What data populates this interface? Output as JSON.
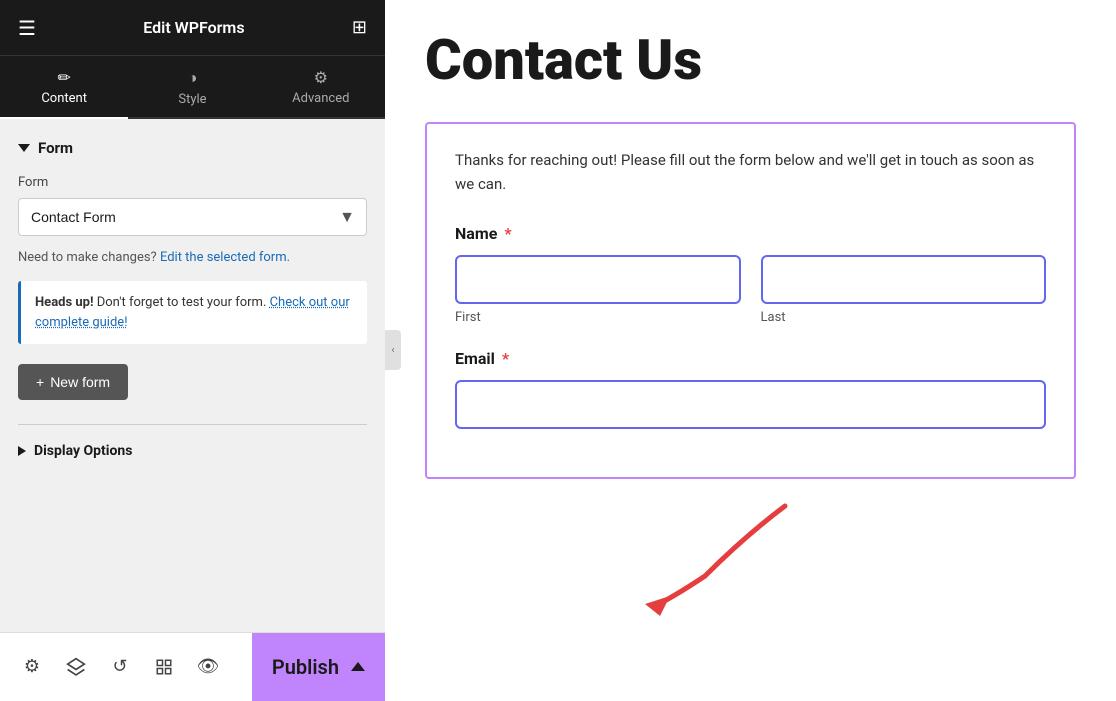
{
  "sidebar": {
    "title": "Edit WPForms",
    "tabs": [
      {
        "id": "content",
        "label": "Content",
        "icon": "✏️",
        "active": true
      },
      {
        "id": "style",
        "label": "Style",
        "icon": "◑",
        "active": false
      },
      {
        "id": "advanced",
        "label": "Advanced",
        "icon": "⚙️",
        "active": false
      }
    ],
    "form_section": {
      "title": "Form",
      "form_label": "Form",
      "form_value": "Contact Form",
      "edit_link_prefix": "Need to make changes?",
      "edit_link_text": "Edit the selected form.",
      "info_box": {
        "bold_text": "Heads up!",
        "text": " Don't forget to test your form. ",
        "link_text": "Check out our complete guide!"
      },
      "new_form_label": "+ New form"
    },
    "display_options": {
      "title": "Display Options"
    },
    "bottom_icons": [
      "gear",
      "layers",
      "history",
      "layout",
      "eye"
    ],
    "publish_label": "Publish"
  },
  "preview": {
    "title": "Contact Us",
    "form": {
      "description": "Thanks for reaching out! Please fill out the form below and we'll get in touch as soon as we can.",
      "fields": [
        {
          "label": "Name",
          "required": true,
          "type": "name",
          "subfields": [
            {
              "placeholder": "",
              "sublabel": "First"
            },
            {
              "placeholder": "",
              "sublabel": "Last"
            }
          ]
        },
        {
          "label": "Email",
          "required": true,
          "type": "email",
          "placeholder": ""
        }
      ]
    }
  }
}
